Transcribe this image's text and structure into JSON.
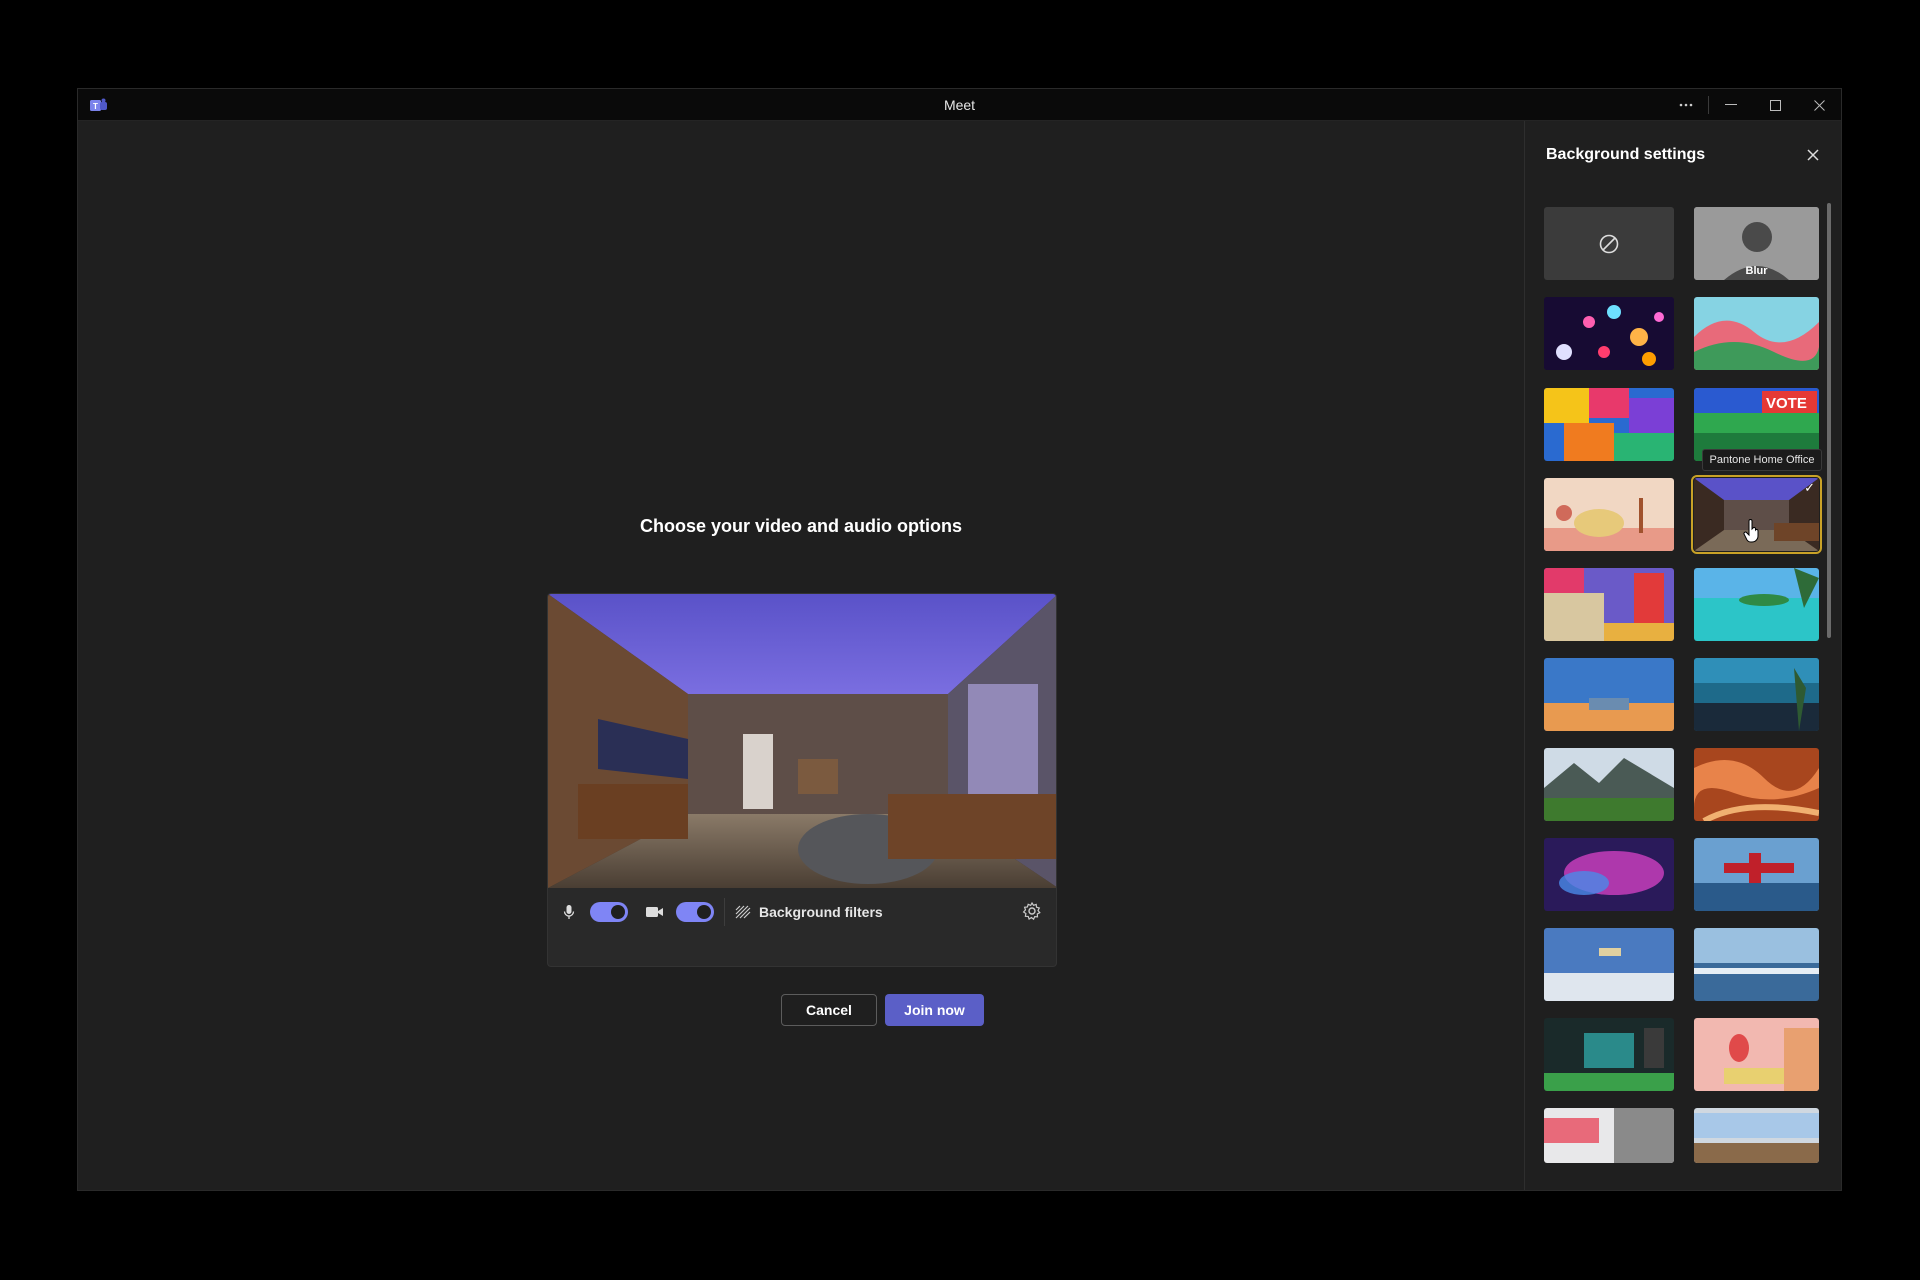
{
  "window": {
    "title": "Meet",
    "app_icon": "teams-logo-icon"
  },
  "main": {
    "heading": "Choose your video and audio options",
    "controls": {
      "mic_icon": "microphone-icon",
      "mic_on": true,
      "camera_icon": "video-camera-icon",
      "camera_on": true,
      "background_filters_label": "Background filters",
      "settings_icon": "gear-icon"
    },
    "buttons": {
      "cancel": "Cancel",
      "join": "Join now"
    }
  },
  "panel": {
    "title": "Background settings",
    "blur_label": "Blur",
    "tooltip": "Pantone Home Office",
    "selected_index": 7,
    "accent_selected": "#c9a227",
    "join_color": "#5b5fc7",
    "toggle_color": "#7f85f5",
    "thumbnails": [
      "none",
      "blur",
      "dots",
      "waves",
      "abstract",
      "vote",
      "cakes",
      "pantone-home-office",
      "shelves",
      "beach",
      "sky",
      "crowd",
      "valley",
      "canyon",
      "galaxy",
      "plane",
      "snow-plane",
      "ice",
      "office",
      "pink-room",
      "loft",
      "interior"
    ]
  }
}
